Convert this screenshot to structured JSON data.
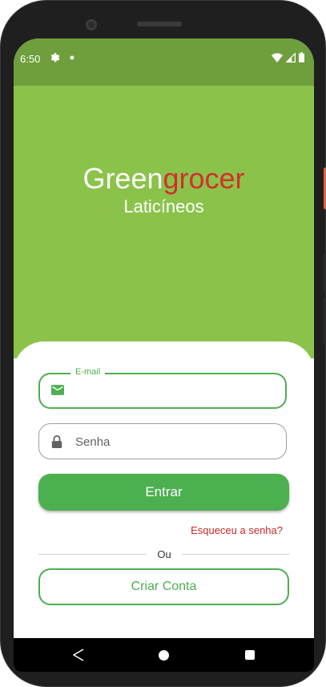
{
  "status_bar": {
    "time": "6:50",
    "icons": [
      "gear-icon",
      "notification-dot-icon",
      "wifi-icon",
      "signal-icon",
      "battery-icon"
    ]
  },
  "brand": {
    "part1": "Green",
    "part2": "grocer",
    "subtitle": "Laticíneos"
  },
  "login": {
    "email_label": "E-mail",
    "email_value": "",
    "password_placeholder": "Senha",
    "submit_label": "Entrar",
    "forgot_label": "Esqueceu a senha?",
    "divider_text": "Ou",
    "create_account_label": "Criar Conta"
  },
  "colors": {
    "primary_green": "#4caf50",
    "hero_green": "#8bc34a",
    "status_green": "#6f9e3c",
    "accent_red": "#d32f2f"
  }
}
